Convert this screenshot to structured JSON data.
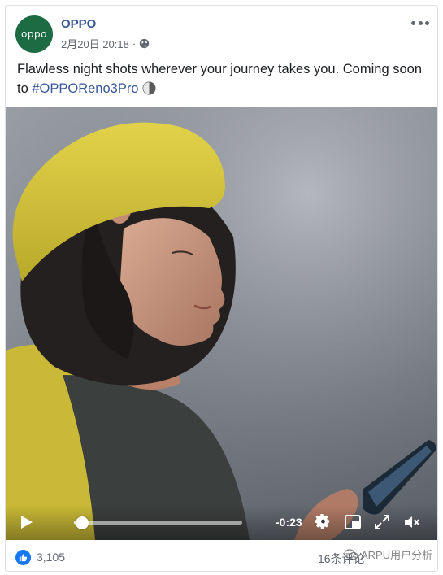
{
  "post": {
    "page_name": "OPPO",
    "avatar_text": "oppo",
    "date": "2月20日 20:18",
    "separator": "·",
    "caption_text": "Flawless night shots wherever your journey takes you. Coming soon to ",
    "hashtag": "#OPPOReno3Pro",
    "privacy_icon": "globe-icon",
    "emoji_icon": "moon-icon"
  },
  "video": {
    "time_remaining": "-0:23",
    "progress": 0.05,
    "icons": [
      "play-icon",
      "gear-icon",
      "pip-icon",
      "fullscreen-icon",
      "mute-icon"
    ]
  },
  "footer": {
    "reaction_count": "3,105",
    "comment_count": "16条评论",
    "watermark_text": "ARPU用户分析"
  },
  "colors": {
    "link": "#385898",
    "brand_green": "#1d6b43",
    "like_blue": "#1877f2",
    "hat_yellow": "#d6c537",
    "secondary_text": "#606770"
  }
}
